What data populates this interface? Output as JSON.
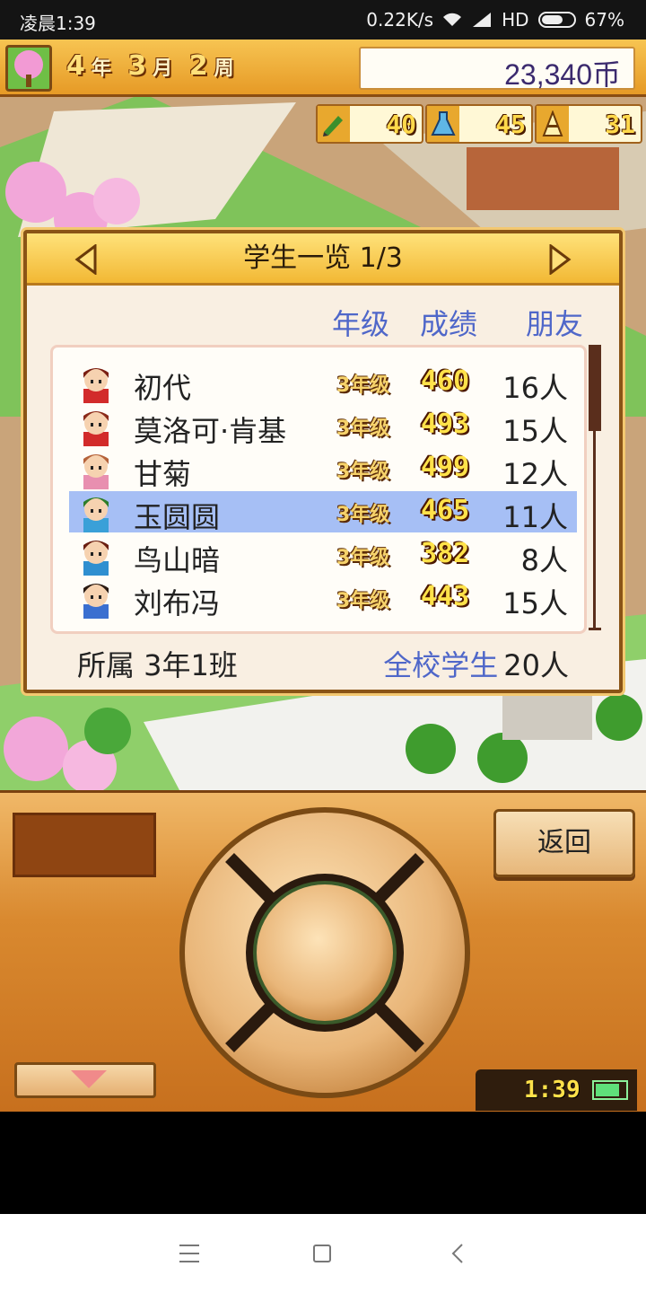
{
  "status": {
    "time": "凌晨1:39",
    "speed": "0.22K/s",
    "network": "HD",
    "battery": "67%",
    "battery_level": 0.67
  },
  "top": {
    "year": "4",
    "year_unit": "年",
    "month": "3",
    "month_unit": "月",
    "week": "2",
    "week_unit": "周",
    "money": "23,340币"
  },
  "stats": [
    {
      "icon": "pencil-icon",
      "value": "40"
    },
    {
      "icon": "flask-icon",
      "value": "45"
    },
    {
      "icon": "tower-icon",
      "value": "31"
    }
  ],
  "dialog": {
    "title": "学生一览 1/3",
    "col_grade": "年级",
    "col_score": "成绩",
    "col_friends": "朋友",
    "students": [
      {
        "name": "初代",
        "grade": "3年级",
        "score": "460",
        "friends": "16人",
        "selected": false,
        "hair": "#7a1e12",
        "shirt": "#d22b2b"
      },
      {
        "name": "莫洛可·肯基",
        "grade": "3年级",
        "score": "493",
        "friends": "15人",
        "selected": false,
        "hair": "#8a2a1a",
        "shirt": "#d22b2b"
      },
      {
        "name": "甘菊",
        "grade": "3年级",
        "score": "499",
        "friends": "12人",
        "selected": false,
        "hair": "#b5623a",
        "shirt": "#e88fb0"
      },
      {
        "name": "玉圆圆",
        "grade": "3年级",
        "score": "465",
        "friends": "11人",
        "selected": true,
        "hair": "#2e7d2a",
        "shirt": "#3aa0d8"
      },
      {
        "name": "鸟山暗",
        "grade": "3年级",
        "score": "382",
        "friends": "8人",
        "selected": false,
        "hair": "#6a1e12",
        "shirt": "#2f8fd0"
      },
      {
        "name": "刘布冯",
        "grade": "3年级",
        "score": "443",
        "friends": "15人",
        "selected": false,
        "hair": "#2a1a12",
        "shirt": "#3a6fd0"
      }
    ],
    "class_label": "所属  3年1班",
    "total_label": "全校学生",
    "total_value": "20人"
  },
  "controller": {
    "back_label": "返回",
    "clock": "1:39"
  },
  "colors": {
    "accent_blue": "#4f67c9",
    "selected_row": "#a6bff5",
    "frame": "#8a5416"
  }
}
